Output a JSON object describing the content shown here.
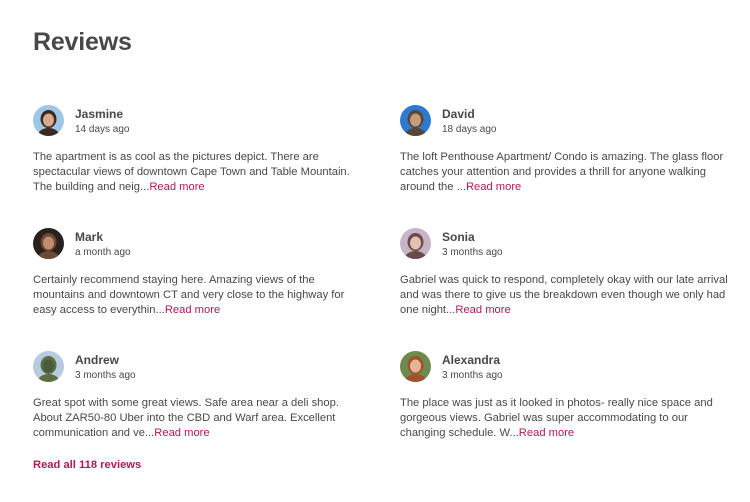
{
  "section": {
    "title": "Reviews",
    "read_all": "Read all 118 reviews"
  },
  "reviews": [
    {
      "name": "Jasmine",
      "date": "14 days ago",
      "text": "The apartment is as cool as the pictures depict. There are spectacular views of downtown Cape Town and Table Mountain. The building and neig...",
      "read_more": "Read more",
      "avatar_colors": [
        "#9cc7e6",
        "#3b2a22",
        "#d9a98c"
      ]
    },
    {
      "name": "David",
      "date": "18 days ago",
      "text": "The loft Penthouse Apartment/ Condo is amazing. The glass floor catches your attention and provides a thrill for anyone walking around the ...",
      "read_more": "Read more",
      "avatar_colors": [
        "#2e7ad1",
        "#5a4636",
        "#c79a7c"
      ]
    },
    {
      "name": "Mark",
      "date": "a month ago",
      "text": "Certainly recommend staying here. Amazing views of the mountains and downtown CT and very close to the highway for easy access to everythin...",
      "read_more": "Read more",
      "avatar_colors": [
        "#2a211c",
        "#6a4a36",
        "#c48c6e"
      ]
    },
    {
      "name": "Sonia",
      "date": "3 months ago",
      "text": "Gabriel was quick to respond, completely okay with our late arrival and was there to give us the breakdown even though we only had one night...",
      "read_more": "Read more",
      "avatar_colors": [
        "#c8b4c8",
        "#6b4a4a",
        "#e3c0b0"
      ]
    },
    {
      "name": "Andrew",
      "date": "3 months ago",
      "text": "Great spot with some great views. Safe area near a deli shop. About ZAR50-80 Uber into the CBD and Warf area. Excellent communication and ve...",
      "read_more": "Read more",
      "avatar_colors": [
        "#b7cbe0",
        "#5d6e45",
        "#4a5a3a"
      ]
    },
    {
      "name": "Alexandra",
      "date": "3 months ago",
      "text": "The place was just as it looked in photos- really nice space and gorgeous views. Gabriel was super accommodating to our changing schedule. W...",
      "read_more": "Read more",
      "avatar_colors": [
        "#6f8a4e",
        "#a0522d",
        "#e2b597"
      ]
    }
  ],
  "colors": {
    "text": "#484848",
    "accent": "#b4175a"
  }
}
